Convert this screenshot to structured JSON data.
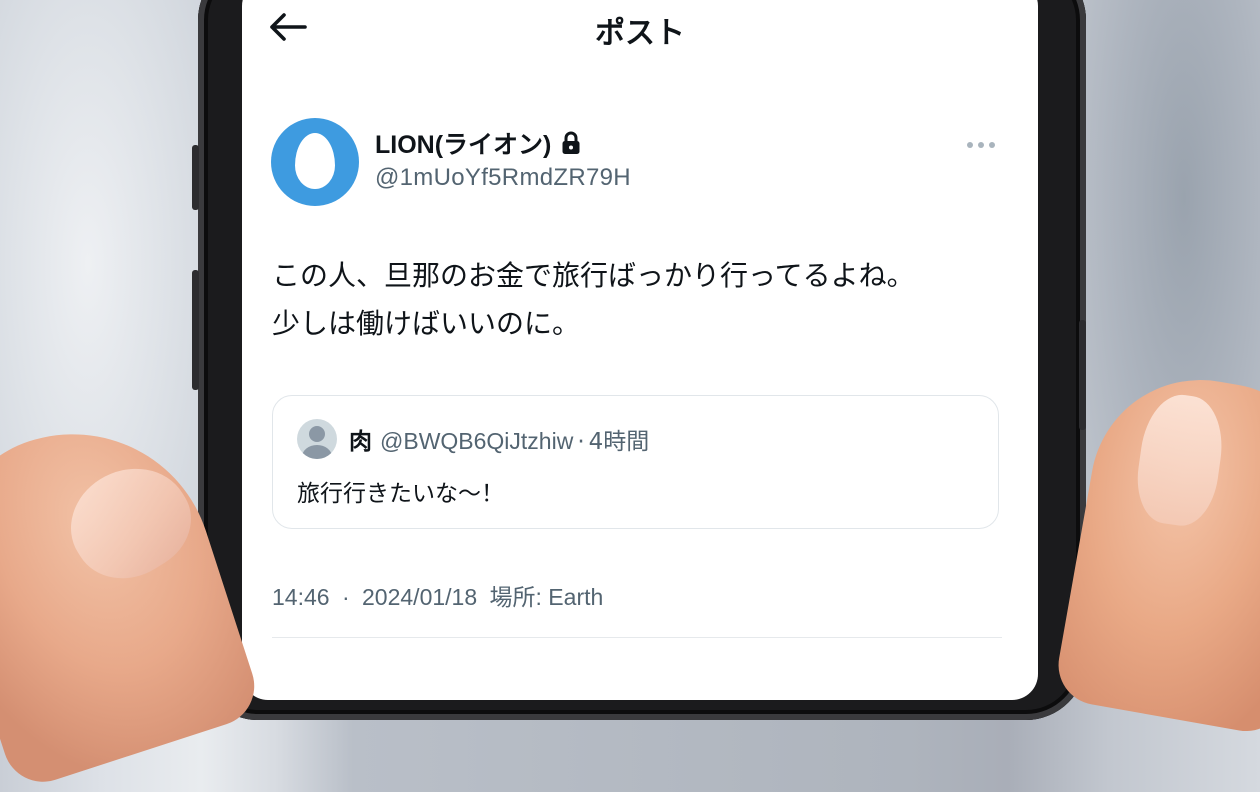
{
  "header": {
    "title": "ポスト",
    "back_icon": "arrow-left-icon"
  },
  "post": {
    "author": {
      "display_name": "LION(ライオン)",
      "handle": "@1mUoYf5RmdZR79H",
      "avatar_color": "#3e9be0",
      "protected_icon": "lock-icon"
    },
    "more_icon": "more-horizontal-icon",
    "text_line1": "この人、旦那のお金で旅行ばっかり行ってるよね。",
    "text_line2": "少しは働けばいいのに。",
    "quote": {
      "name": "肉",
      "handle": "@BWQB6QiJtzhiw",
      "separator": "·",
      "time": "4時間",
      "text": "旅行行きたいな〜！"
    },
    "meta": {
      "time": "14:46",
      "separator": "·",
      "date": "2024/01/18",
      "location": "場所: Earth"
    }
  },
  "colors": {
    "text_primary": "#0f1419",
    "text_secondary": "#536471",
    "border": "#e1e6ea"
  }
}
